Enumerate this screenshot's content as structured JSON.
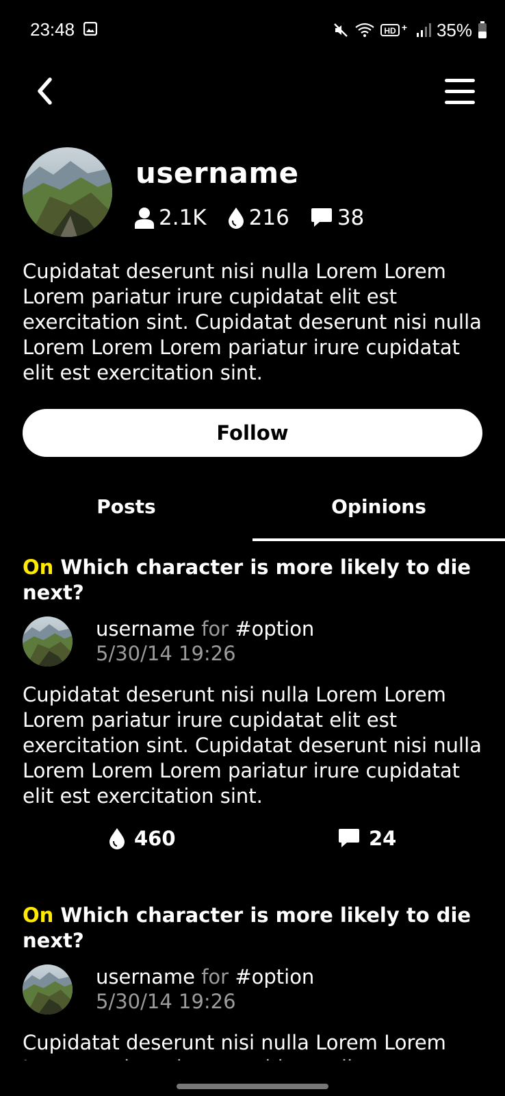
{
  "status_bar": {
    "time": "23:48",
    "battery": "35%",
    "icons": [
      "gallery-icon",
      "mute-icon",
      "wifi-icon",
      "hd-plus-icon",
      "signal-icon",
      "battery-icon"
    ]
  },
  "nav": {
    "back_icon": "chevron-left-icon",
    "menu_icon": "hamburger-menu-icon"
  },
  "profile": {
    "username": "username",
    "followers": "2.1K",
    "drops": "216",
    "comments": "38",
    "bio": "Cupidatat deserunt nisi nulla Lorem Lorem Lorem pariatur irure cupidatat elit est exercitation sint. Cupidatat deserunt nisi nulla Lorem Lorem Lorem pariatur irure cupidatat elit est exercitation sint."
  },
  "follow_label": "Follow",
  "tabs": [
    {
      "label": "Posts",
      "active": false
    },
    {
      "label": "Opinions",
      "active": true
    }
  ],
  "opinions": [
    {
      "on_label": "On",
      "title": "Which character is more likely to die next?",
      "author": "username",
      "for_label": "for",
      "option": "#option",
      "timestamp": "5/30/14 19:26",
      "body": "Cupidatat deserunt nisi nulla Lorem Lorem Lorem pariatur irure cupidatat elit est exercitation sint. Cupidatat deserunt nisi nulla Lorem Lorem Lorem pariatur irure cupidatat elit est exercitation sint.",
      "drops": "460",
      "comments": "24"
    },
    {
      "on_label": "On",
      "title": "Which character is more likely to die next?",
      "author": "username",
      "for_label": "for",
      "option": "#option",
      "timestamp": "5/30/14 19:26",
      "body": "Cupidatat deserunt nisi nulla Lorem Lorem Lorem pariatur irure cupidatat elit est"
    }
  ],
  "colors": {
    "background": "#000000",
    "text": "#ffffff",
    "accent_on": "#ffea00",
    "muted": "#9c9c9c"
  }
}
